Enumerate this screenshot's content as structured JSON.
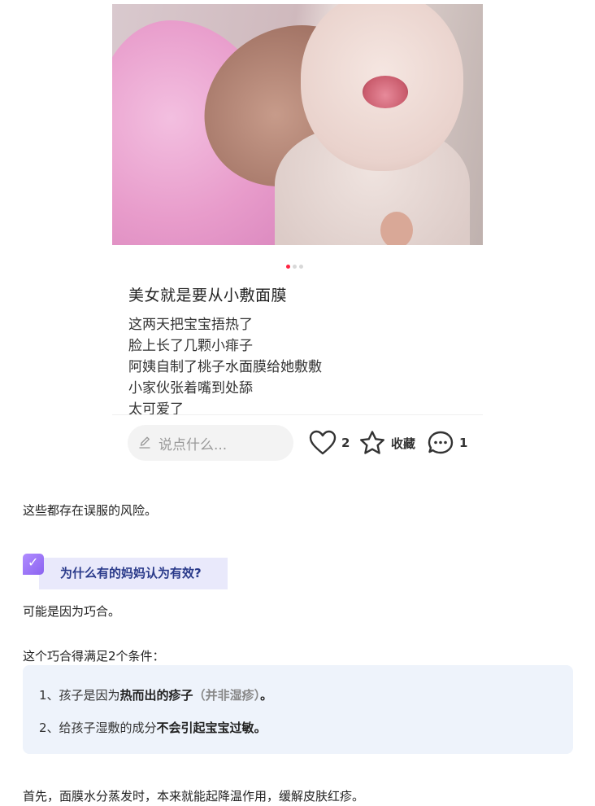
{
  "post": {
    "title": "美女就是要从小敷面膜",
    "lines": [
      "这两天把宝宝捂热了",
      "脸上长了几颗小痱子",
      "阿姨自制了桃子水面膜给她敷敷",
      "小家伙张着嘴到处舔",
      "太可爱了"
    ],
    "carousel": {
      "count": 3,
      "active": 1
    },
    "accent": "#ff2442",
    "highlight_color": "#e0202c"
  },
  "actions": {
    "comment_placeholder": "说点什么...",
    "like_count": "2",
    "collect_label": "收藏",
    "comment_count": "1"
  },
  "article": {
    "p1": "这些都存在误服的风险。",
    "question_icon": "check-icon",
    "question": "为什么有的妈妈认为有效?",
    "p2": "可能是因为巧合。",
    "p3": "这个巧合得满足2个条件：",
    "item1_prefix": "1、孩子是因为",
    "item1_bold": "热而出的疹子",
    "item1_muted": "（并非湿疹）",
    "item1_suffix": "。",
    "item2_prefix": "2、给孩子湿敷的成分",
    "item2_bold": "不会引起宝宝过敏",
    "item2_suffix": "。",
    "p4": "首先，面膜水分蒸发时，本来就能起降温作用，缓解皮肤红疹。"
  }
}
